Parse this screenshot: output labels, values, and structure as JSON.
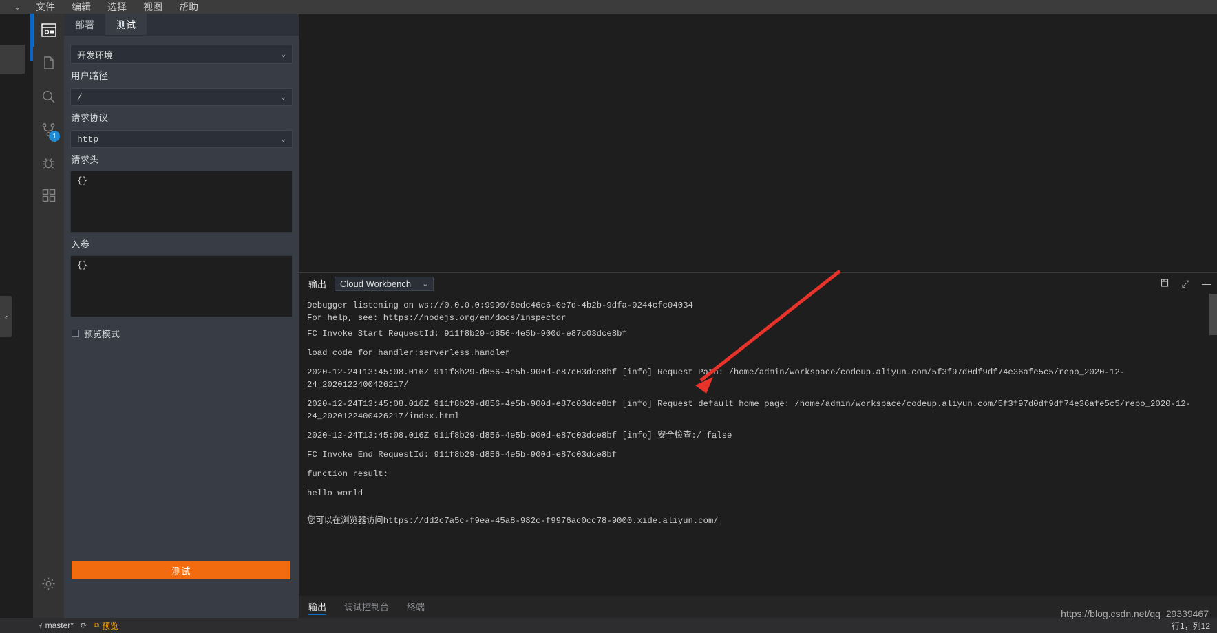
{
  "menubar": {
    "items": [
      "文件",
      "编辑",
      "选择",
      "视图",
      "帮助"
    ]
  },
  "activity_bar": {
    "items": [
      {
        "name": "serverless-icon",
        "label": "Serverless"
      },
      {
        "name": "files-icon",
        "label": "资源管理器"
      },
      {
        "name": "search-icon",
        "label": "搜索"
      },
      {
        "name": "source-control-icon",
        "label": "源代码管理",
        "badge": "1"
      },
      {
        "name": "debug-icon",
        "label": "运行和调试"
      },
      {
        "name": "extensions-icon",
        "label": "扩展"
      }
    ],
    "settings_label": "设置"
  },
  "side_panel": {
    "tabs": [
      {
        "label": "部署",
        "active": false
      },
      {
        "label": "测试",
        "active": true
      }
    ],
    "environment": {
      "value": "开发环境"
    },
    "fields": [
      {
        "label": "用户路径",
        "value": "/",
        "type": "select"
      },
      {
        "label": "请求协议",
        "value": "http",
        "type": "select"
      },
      {
        "label": "请求头",
        "value": "{}",
        "type": "code"
      },
      {
        "label": "入参",
        "value": "{}",
        "type": "code"
      }
    ],
    "preview_mode": {
      "label": "预览模式",
      "checked": false
    },
    "test_button": "测试"
  },
  "output_panel": {
    "tab_label": "输出",
    "channel": "Cloud Workbench",
    "actions": [
      {
        "name": "clear-output-icon",
        "glyph": "🗑"
      },
      {
        "name": "maximize-panel-icon",
        "glyph": "⤢"
      },
      {
        "name": "close-panel-icon",
        "glyph": "—"
      }
    ],
    "logs": [
      "Debugger listening on ws://0.0.0.0:9999/6edc46c6-0e7d-4b2b-9dfa-9244cfc04034",
      "For help, see: https://nodejs.org/en/docs/inspector",
      "FC Invoke Start RequestId: 911f8b29-d856-4e5b-900d-e87c03dce8bf",
      "load code for handler:serverless.handler",
      "2020-12-24T13:45:08.016Z 911f8b29-d856-4e5b-900d-e87c03dce8bf [info] Request Path: /home/admin/workspace/codeup.aliyun.com/5f3f97d0df9df74e36afe5c5/repo_2020-12-24_2020122400426217/",
      "2020-12-24T13:45:08.016Z 911f8b29-d856-4e5b-900d-e87c03dce8bf [info] Request default home page: /home/admin/workspace/codeup.aliyun.com/5f3f97d0df9df74e36afe5c5/repo_2020-12-24_2020122400426217/index.html",
      "2020-12-24T13:45:08.016Z 911f8b29-d856-4e5b-900d-e87c03dce8bf [info] 安全检查:/ false",
      "FC Invoke End RequestId: 911f8b29-d856-4e5b-900d-e87c03dce8bf",
      "function result:",
      "hello world"
    ],
    "help_link": "https://nodejs.org/en/docs/inspector",
    "footer_prefix": "您可以在浏览器访问",
    "footer_link": "https://dd2c7a5c-f9ea-45a8-982c-f9976ac0cc78-9000.xide.aliyun.com/"
  },
  "bottom_tabs": [
    {
      "label": "输出",
      "active": true
    },
    {
      "label": "调试控制台",
      "active": false
    },
    {
      "label": "终端",
      "active": false
    }
  ],
  "status_bar": {
    "branch": "master*",
    "preview": "预览",
    "cursor": "行1，列12",
    "watermark": "https://blog.csdn.net/qq_29339467"
  },
  "colors": {
    "accent_orange": "#f26b0f",
    "accent_blue": "#0e70c0",
    "badge_blue": "#1f8ad2",
    "panel_bg": "#383d45",
    "editor_bg": "#1e1e1e"
  }
}
